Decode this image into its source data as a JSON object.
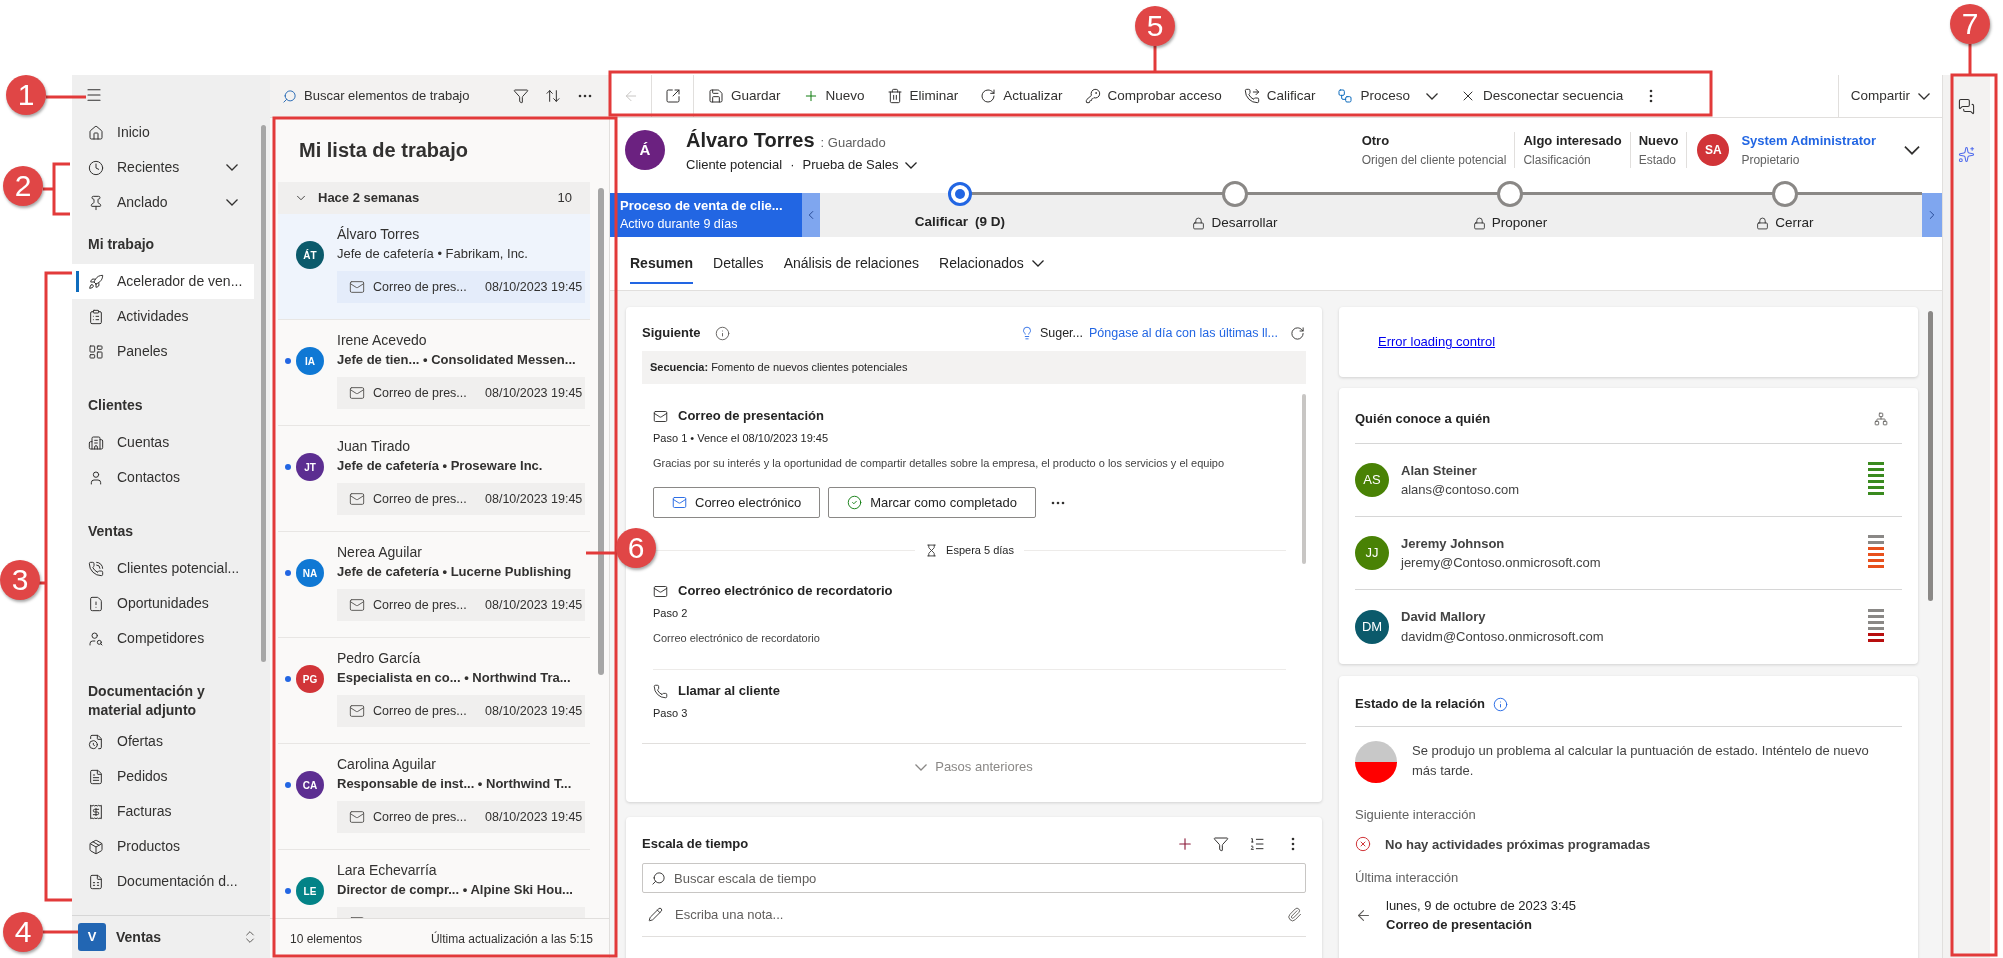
{
  "nav": {
    "top_items": [
      {
        "label": "Inicio"
      },
      {
        "label": "Recientes",
        "expanded": false
      },
      {
        "label": "Anclado",
        "expanded": false
      }
    ],
    "groups": [
      {
        "title": "Mi trabajo",
        "items": [
          {
            "label": "Acelerador de ven...",
            "selected": true
          },
          {
            "label": "Actividades",
            "selected": false
          },
          {
            "label": "Paneles",
            "selected": false
          }
        ]
      },
      {
        "title": "Clientes",
        "items": [
          {
            "label": "Cuentas",
            "selected": false
          },
          {
            "label": "Contactos",
            "selected": false
          }
        ]
      },
      {
        "title": "Ventas",
        "items": [
          {
            "label": "Clientes potencial...",
            "selected": false
          },
          {
            "label": "Oportunidades",
            "selected": false
          },
          {
            "label": "Competidores",
            "selected": false
          }
        ]
      },
      {
        "title": "Documentación y material adjunto",
        "items": [
          {
            "label": "Ofertas",
            "selected": false
          },
          {
            "label": "Pedidos",
            "selected": false
          },
          {
            "label": "Facturas",
            "selected": false
          },
          {
            "label": "Productos",
            "selected": false
          },
          {
            "label": "Documentación d...",
            "selected": false
          }
        ]
      }
    ],
    "area": {
      "initial": "V",
      "label": "Ventas"
    }
  },
  "worklist": {
    "search_placeholder": "Buscar elementos de trabajo",
    "title": "Mi lista de trabajo",
    "group": {
      "label": "Hace 2 semanas",
      "count": "10",
      "expanded": true
    },
    "items": [
      {
        "initials": "ÁT",
        "name": "Álvaro Torres",
        "subtitle": "Jefe de cafetería • Fabrikam, Inc.",
        "color": "#0b5a6b",
        "unread": false,
        "selected": true,
        "activity": "Correo de pres...",
        "date": "08/10/2023 19:45"
      },
      {
        "initials": "IA",
        "name": "Irene Acevedo",
        "subtitle": "Jefe de tien... • Consolidated Messen...",
        "color": "#0f78d4",
        "unread": true,
        "selected": false,
        "activity": "Correo de pres...",
        "date": "08/10/2023 19:45"
      },
      {
        "initials": "JT",
        "name": "Juan Tirado",
        "subtitle": "Jefe de cafetería • Proseware Inc.",
        "color": "#5c2e91",
        "unread": true,
        "selected": false,
        "activity": "Correo de pres...",
        "date": "08/10/2023 19:45"
      },
      {
        "initials": "NA",
        "name": "Nerea Aguilar",
        "subtitle": "Jefe de cafetería • Lucerne Publishing",
        "color": "#0f78d4",
        "unread": true,
        "selected": false,
        "activity": "Correo de pres...",
        "date": "08/10/2023 19:45"
      },
      {
        "initials": "PG",
        "name": "Pedro García",
        "subtitle": "Especialista en co... • Northwind Tra...",
        "color": "#d13438",
        "unread": true,
        "selected": false,
        "activity": "Correo de pres...",
        "date": "08/10/2023 19:45"
      },
      {
        "initials": "CA",
        "name": "Carolina Aguilar",
        "subtitle": "Responsable de inst... • Northwind T...",
        "color": "#5c2e91",
        "unread": true,
        "selected": false,
        "activity": "Correo de pres...",
        "date": "08/10/2023 19:45"
      },
      {
        "initials": "LE",
        "name": "Lara Echevarría",
        "subtitle": "Director de compr... • Alpine Ski Hou...",
        "color": "#038387",
        "unread": true,
        "selected": false
      }
    ],
    "footer": {
      "count": "10 elementos",
      "updated": "Última actualización a las 5:15"
    }
  },
  "command_bar": {
    "nav_buttons": [
      {
        "disabled": true
      },
      {
        "disabled": false
      }
    ],
    "commands": [
      {
        "label": "Guardar"
      },
      {
        "label": "Nuevo"
      },
      {
        "label": "Eliminar"
      },
      {
        "label": "Actualizar"
      },
      {
        "label": "Comprobar acceso"
      },
      {
        "label": "Calificar"
      },
      {
        "label": "Proceso",
        "menu": true
      },
      {
        "label": "Desconectar secuencia"
      }
    ],
    "share": {
      "label": "Compartir"
    }
  },
  "header": {
    "avatar": {
      "initial": "Á",
      "color": "#6b2180"
    },
    "name": "Álvaro Torres",
    "save_status": ": Guardado",
    "entity": "Cliente potencial",
    "separator": "·",
    "form": "Prueba de Sales",
    "fields": [
      {
        "value": "Otro",
        "label": "Origen del cliente potencial"
      },
      {
        "value": "Algo interesado",
        "label": "Clasificación"
      },
      {
        "value": "Nuevo",
        "label": "Estado"
      }
    ],
    "owner": {
      "initials": "SA",
      "color": "#d13438",
      "name": "System Administrator",
      "label": "Propietario"
    }
  },
  "process": {
    "name": "Proceso de venta de clie...",
    "duration": "Activo durante 9 días",
    "stages": [
      {
        "label": "Calificar",
        "days": "(9 D)",
        "selected": true,
        "locked": false
      },
      {
        "label": "Desarrollar",
        "selected": false,
        "locked": true
      },
      {
        "label": "Proponer",
        "selected": false,
        "locked": true
      },
      {
        "label": "Cerrar",
        "selected": false,
        "locked": true
      }
    ]
  },
  "tabs": [
    {
      "label": "Resumen",
      "selected": true
    },
    {
      "label": "Detalles",
      "selected": false
    },
    {
      "label": "Análisis de relaciones",
      "selected": false
    },
    {
      "label": "Relacionados",
      "selected": false,
      "menu": true
    }
  ],
  "up_next": {
    "title": "Siguiente",
    "suggestion_label": "Suger...",
    "suggestion_link": "Póngase al día con las últimas ll...",
    "sequence": "**Secuencia:** Fomento de nuevos clientes potenciales",
    "steps": [
      {
        "kind": "email",
        "title": "Correo de presentación",
        "meta": "Paso 1 • Vence el 08/10/2023 19:45",
        "description": "Gracias por su interés y la oportunidad de compartir detalles sobre la empresa, el producto o los servicios y el equipo",
        "actions": [
          "Correo electrónico",
          "Marcar como completado"
        ],
        "wait": "Espera 5 días"
      },
      {
        "kind": "email",
        "title": "Correo electrónico de recordatorio",
        "meta": "Paso 2",
        "description": "Correo electrónico de recordatorio"
      },
      {
        "kind": "call",
        "title": "Llamar al cliente",
        "meta": "Paso 3"
      }
    ],
    "previous": "Pasos anteriores"
  },
  "timeline": {
    "title": "Escala de tiempo",
    "search_placeholder": "Buscar escala de tiempo",
    "note_placeholder": "Escriba una nota..."
  },
  "error_card": {
    "link": "Error loading control"
  },
  "who_knows": {
    "title": "Quién conoce a quién",
    "people": [
      {
        "initials": "AS",
        "name": "Alan Steiner",
        "email": "alans@contoso.com",
        "color": "#498205",
        "strength": {
          "level": 1,
          "color": "#3a8a1f"
        }
      },
      {
        "initials": "JJ",
        "name": "Jeremy Johnson",
        "email": "jeremy@Contoso.onmicrosoft.com",
        "color": "#498205",
        "strength": {
          "level": 0.667,
          "color": "#e8501c"
        }
      },
      {
        "initials": "DM",
        "name": "David Mallory",
        "email": "davidm@Contoso.onmicrosoft.com",
        "color": "#0b5a6b",
        "strength": {
          "level": 0.333,
          "color": "#b80e0e"
        }
      }
    ]
  },
  "relationship": {
    "title": "Estado de la relación",
    "message": "Se produjo un problema al calcular la puntuación de estado. Inténtelo de nuevo más tarde.",
    "next_label": "Siguiente interacción",
    "next_value": "No hay actividades próximas programadas",
    "last_label": "Última interacción",
    "last_date": "lunes, 9 de octubre de 2023 3:45",
    "last_activity": "Correo de presentación"
  },
  "callouts": [
    {
      "number": "1"
    },
    {
      "number": "2"
    },
    {
      "number": "3"
    },
    {
      "number": "4"
    },
    {
      "number": "5"
    },
    {
      "number": "6"
    },
    {
      "number": "7"
    }
  ]
}
